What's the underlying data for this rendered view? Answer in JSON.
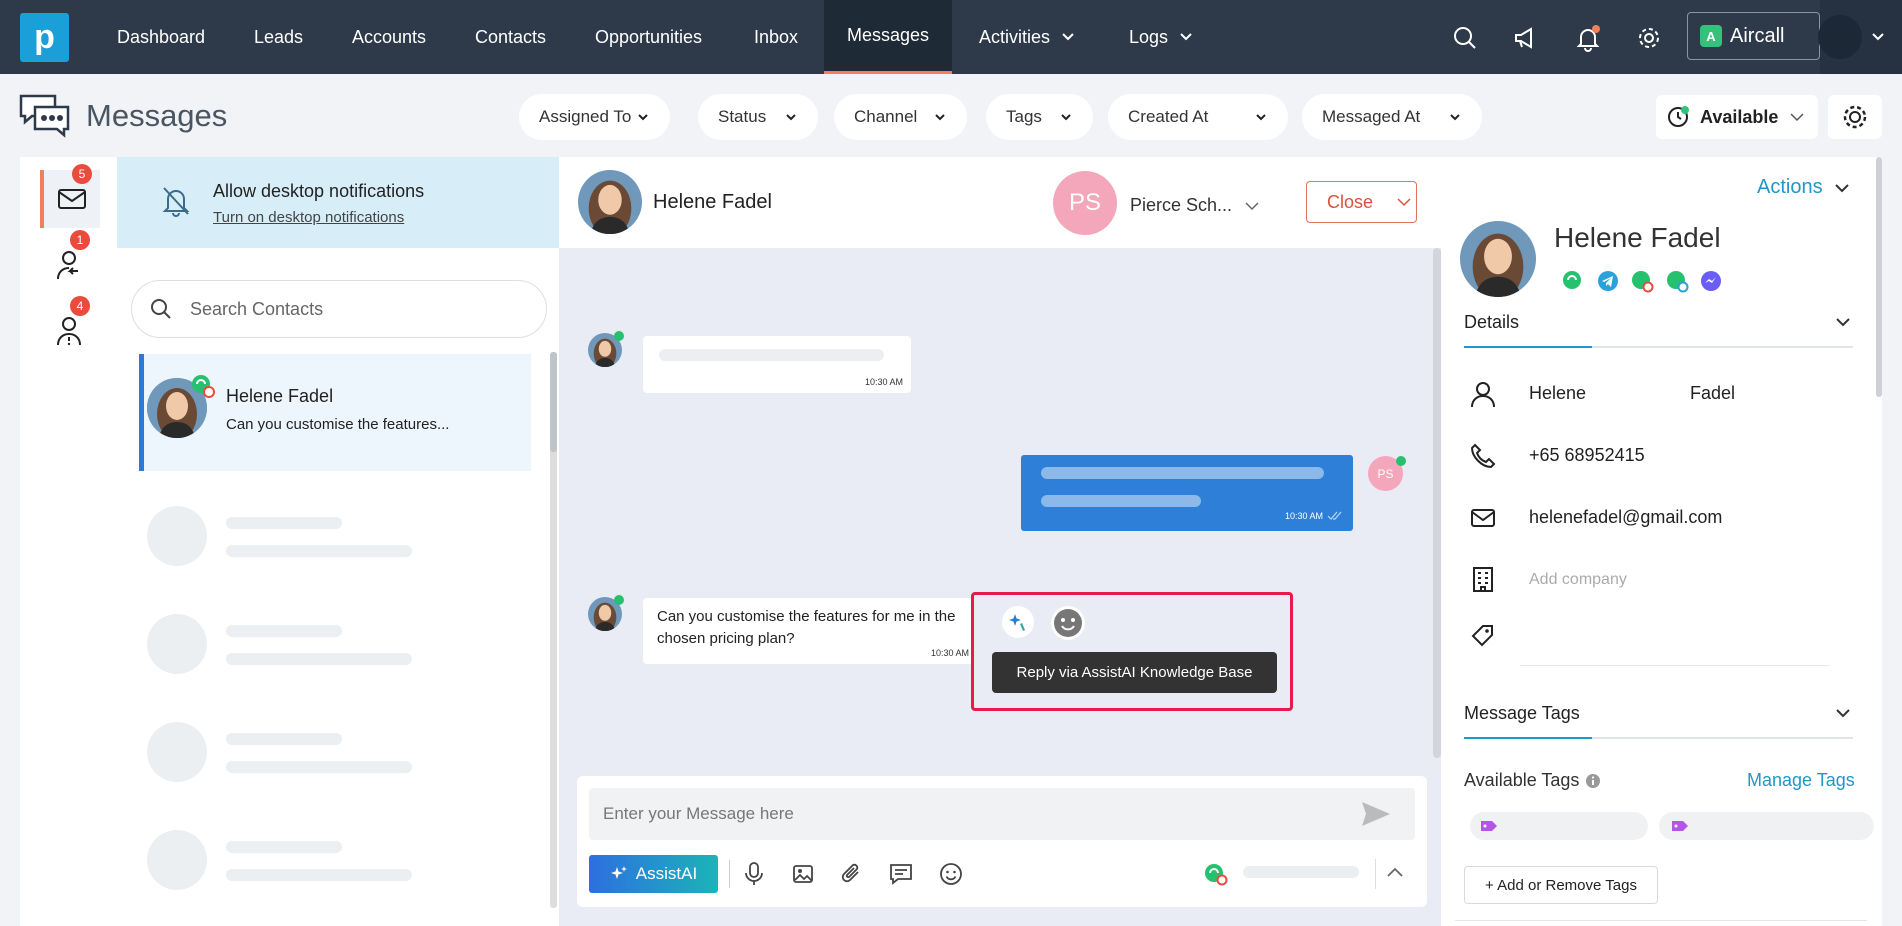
{
  "nav": {
    "logo_letter": "p",
    "items": [
      "Dashboard",
      "Leads",
      "Accounts",
      "Contacts",
      "Opportunities",
      "Inbox",
      "Messages",
      "Activities",
      "Logs"
    ],
    "active": "Messages",
    "aircall_label": "Aircall"
  },
  "header": {
    "title": "Messages",
    "filters": [
      "Assigned To",
      "Status",
      "Channel",
      "Tags",
      "Created At",
      "Messaged At"
    ],
    "availability": "Available"
  },
  "rail": {
    "badges": {
      "inbox": "5",
      "reassigned": "1",
      "alerts": "4"
    }
  },
  "notification": {
    "title": "Allow desktop notifications",
    "link": "Turn on desktop notifications"
  },
  "contacts": {
    "search_placeholder": "Search Contacts",
    "items": [
      {
        "name": "Helene Fadel",
        "preview": "Can you customise the features..."
      }
    ]
  },
  "chat": {
    "contact_name": "Helene Fadel",
    "assignee_initials": "PS",
    "assignee_name": "Pierce Sch...",
    "close_label": "Close",
    "messages": [
      {
        "time": "10:30 AM"
      },
      {
        "time": "10:30 AM",
        "sender_initials": "PS"
      },
      {
        "text_line1": "Can you customise the features for me in the",
        "text_line2": "chosen pricing plan?",
        "time": "10:30 AM"
      }
    ],
    "tooltip": "Reply via AssistAI Knowledge Base",
    "input_placeholder": "Enter your Message here",
    "assistai_label": "AssistAI"
  },
  "details": {
    "actions_label": "Actions",
    "name": "Helene Fadel",
    "details_title": "Details",
    "first_name": "Helene",
    "last_name": "Fadel",
    "phone": "+65 68952415",
    "email": "helenefadel@gmail.com",
    "company_placeholder": "Add company",
    "message_tags_title": "Message Tags",
    "available_tags_label": "Available Tags",
    "manage_tags_label": "Manage Tags",
    "add_tags_label": "+ Add or Remove Tags"
  },
  "colors": {
    "accent": "#2196c8",
    "nav_bg": "#2e3a4a",
    "active_underline": "#f27f59",
    "badge": "#e94b3c",
    "outgoing_bubble": "#2d7fd8",
    "highlight": "#e8194b"
  }
}
